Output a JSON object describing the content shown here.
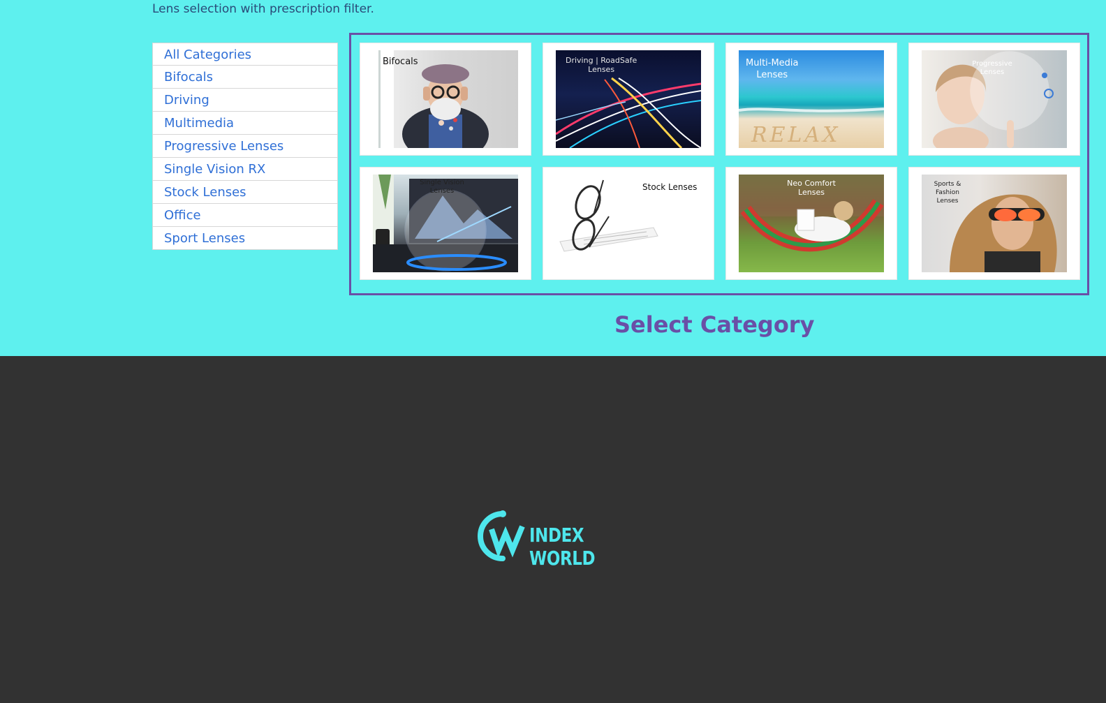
{
  "intro_text": "Lens selection with prescription filter.",
  "categories": [
    {
      "label": "All Categories"
    },
    {
      "label": "Bifocals"
    },
    {
      "label": "Driving"
    },
    {
      "label": "Multimedia"
    },
    {
      "label": "Progressive Lenses"
    },
    {
      "label": "Single Vision RX"
    },
    {
      "label": "Stock Lenses"
    },
    {
      "label": "Office"
    },
    {
      "label": "Sport Lenses"
    }
  ],
  "cards": [
    {
      "caption": "Bifocals"
    },
    {
      "caption_1": "Driving | RoadSafe",
      "caption_2": "Lenses"
    },
    {
      "caption_1": "Multi-Media",
      "caption_2": "Lenses",
      "art": "RELAX"
    },
    {
      "caption_1": "Progressive",
      "caption_2": "Lenses"
    },
    {
      "caption_1": "Single Vision",
      "caption_2": "Lenses"
    },
    {
      "caption": "Stock Lenses"
    },
    {
      "caption_1": "Neo Comfort",
      "caption_2": "Lenses"
    },
    {
      "caption_1": "Sports & Fashion",
      "caption_2": "Lenses"
    }
  ],
  "select_title": "Select Category",
  "footer": {
    "logo_text": "INDEX WORLD"
  },
  "colors": {
    "accent": "#6a4fa6",
    "top_bg": "#5ef0ee",
    "footer_bg": "#323232",
    "link": "#2f6fd6",
    "logo": "#4ee6ec"
  }
}
